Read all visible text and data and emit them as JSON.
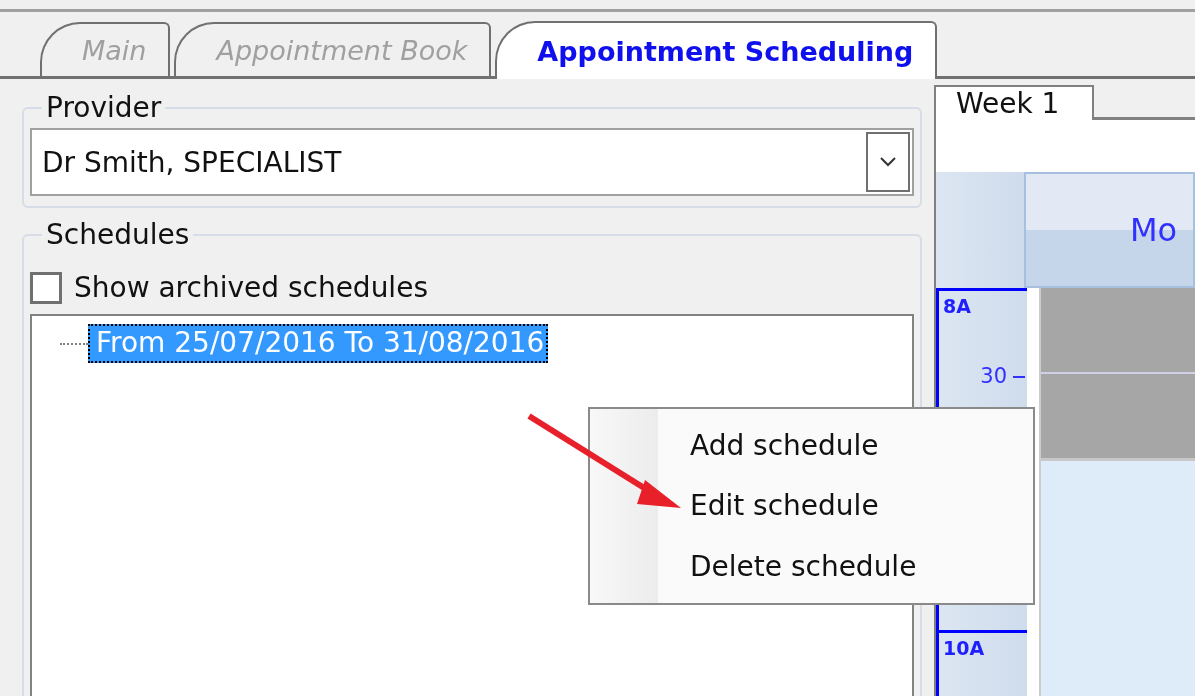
{
  "tabs": [
    {
      "label": "Main",
      "selected": false
    },
    {
      "label": "Appointment Book",
      "selected": false
    },
    {
      "label": "Appointment Scheduling",
      "selected": true
    }
  ],
  "provider": {
    "title": "Provider",
    "value": "Dr Smith, SPECIALIST"
  },
  "schedules": {
    "title": "Schedules",
    "show_archived": {
      "label": "Show archived schedules",
      "checked": false
    },
    "items": [
      {
        "label": "From 25/07/2016 To 31/08/2016",
        "selected": true
      }
    ]
  },
  "context_menu": {
    "items": [
      "Add schedule",
      "Edit schedule",
      "Delete schedule"
    ]
  },
  "calendar": {
    "tabs": [
      {
        "label": "Week 1",
        "selected": true
      }
    ],
    "day_header": "Mo",
    "times": [
      {
        "kind": "hour",
        "label": "8A"
      },
      {
        "kind": "half",
        "label": "30"
      },
      {
        "kind": "hour",
        "label": "10A"
      }
    ]
  }
}
